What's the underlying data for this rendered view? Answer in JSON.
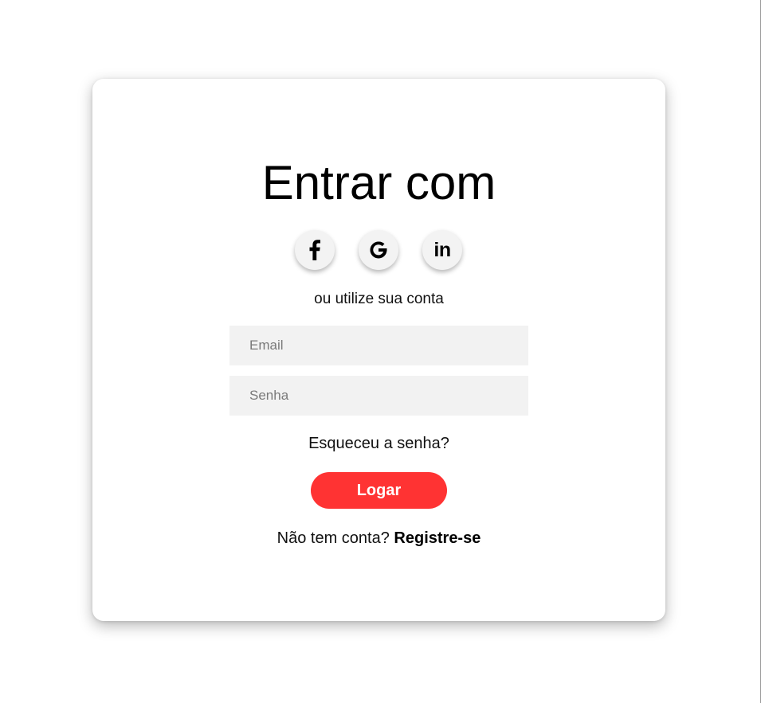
{
  "login": {
    "title": "Entrar com",
    "social": [
      {
        "name": "facebook",
        "icon": "facebook-icon",
        "glyph": "f"
      },
      {
        "name": "google",
        "icon": "google-icon",
        "glyph": "G"
      },
      {
        "name": "linkedin",
        "icon": "linkedin-icon",
        "glyph": "in"
      }
    ],
    "subtitle": "ou utilize sua conta",
    "email_placeholder": "Email",
    "password_placeholder": "Senha",
    "forgot_label": "Esqueceu a senha?",
    "submit_label": "Logar",
    "register_prompt": "Não tem conta?",
    "register_link": "Registre-se"
  },
  "colors": {
    "accent": "#ff3333",
    "input_background": "#f2f2f2",
    "social_background": "#f3f3f3",
    "card_background": "#ffffff"
  }
}
